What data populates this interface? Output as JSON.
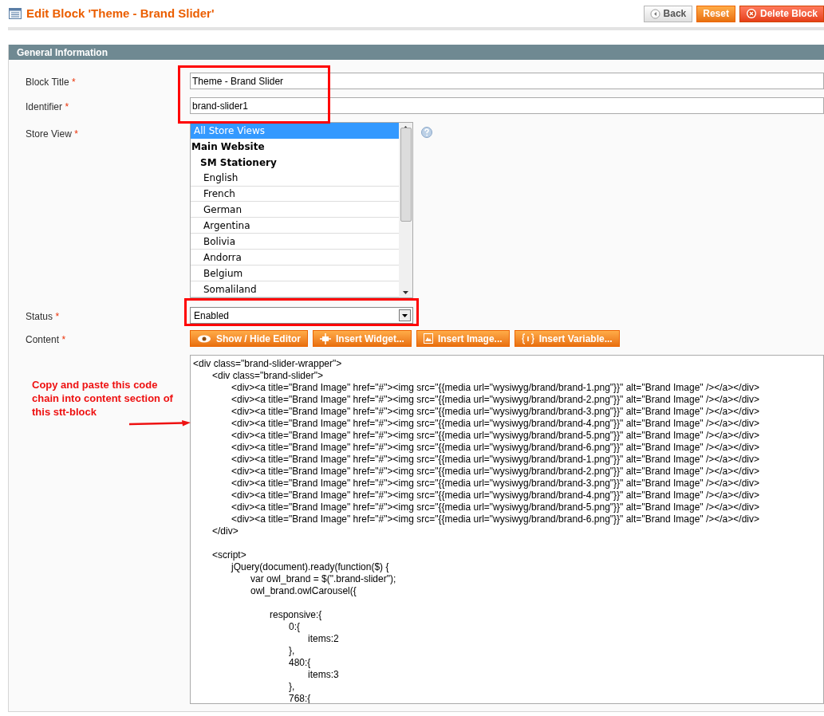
{
  "header": {
    "title": "Edit Block 'Theme - Brand Slider'",
    "buttons": [
      {
        "kind": "back",
        "label": "Back"
      },
      {
        "kind": "reset",
        "label": "Reset"
      },
      {
        "kind": "delete",
        "label": "Delete Block"
      }
    ]
  },
  "section": {
    "title": "General Information"
  },
  "fields": {
    "block_title": {
      "label": "Block Title",
      "required_mark": "*",
      "value": "Theme - Brand Slider"
    },
    "identifier": {
      "label": "Identifier",
      "required_mark": "*",
      "value": "brand-slider1"
    },
    "store_view": {
      "label": "Store View",
      "required_mark": "*",
      "options": [
        {
          "kind": "option",
          "label": "All Store Views",
          "selected": true
        },
        {
          "kind": "website",
          "label": "Main Website",
          "selected": false
        },
        {
          "kind": "store",
          "label": "SM Stationery",
          "selected": false
        },
        {
          "kind": "view",
          "label": "English",
          "selected": false
        },
        {
          "kind": "view",
          "label": "French",
          "selected": false
        },
        {
          "kind": "view",
          "label": "German",
          "selected": false
        },
        {
          "kind": "view",
          "label": "Argentina",
          "selected": false
        },
        {
          "kind": "view",
          "label": "Bolivia",
          "selected": false
        },
        {
          "kind": "view",
          "label": "Andorra",
          "selected": false
        },
        {
          "kind": "view",
          "label": "Belgium",
          "selected": false
        },
        {
          "kind": "view",
          "label": "Somaliland",
          "selected": false
        }
      ]
    },
    "status": {
      "label": "Status",
      "required_mark": "*",
      "value": "Enabled"
    },
    "content": {
      "label": "Content",
      "required_mark": "*",
      "buttons": [
        {
          "kind": "editor",
          "label": "Show / Hide Editor"
        },
        {
          "kind": "widget",
          "label": "Insert Widget..."
        },
        {
          "kind": "image",
          "label": "Insert Image..."
        },
        {
          "kind": "variable",
          "label": "Insert Variable..."
        }
      ],
      "value": "<div class=\"brand-slider-wrapper\">\n\t<div class=\"brand-slider\">\n\t\t<div><a title=\"Brand Image\" href=\"#\"><img src=\"{{media url=\"wysiwyg/brand/brand-1.png\"}}\" alt=\"Brand Image\" /></a></div>\n\t\t<div><a title=\"Brand Image\" href=\"#\"><img src=\"{{media url=\"wysiwyg/brand/brand-2.png\"}}\" alt=\"Brand Image\" /></a></div>\n\t\t<div><a title=\"Brand Image\" href=\"#\"><img src=\"{{media url=\"wysiwyg/brand/brand-3.png\"}}\" alt=\"Brand Image\" /></a></div>\n\t\t<div><a title=\"Brand Image\" href=\"#\"><img src=\"{{media url=\"wysiwyg/brand/brand-4.png\"}}\" alt=\"Brand Image\" /></a></div>\n\t\t<div><a title=\"Brand Image\" href=\"#\"><img src=\"{{media url=\"wysiwyg/brand/brand-5.png\"}}\" alt=\"Brand Image\" /></a></div>\n\t\t<div><a title=\"Brand Image\" href=\"#\"><img src=\"{{media url=\"wysiwyg/brand/brand-6.png\"}}\" alt=\"Brand Image\" /></a></div>\n\t\t<div><a title=\"Brand Image\" href=\"#\"><img src=\"{{media url=\"wysiwyg/brand/brand-1.png\"}}\" alt=\"Brand Image\" /></a></div>\n\t\t<div><a title=\"Brand Image\" href=\"#\"><img src=\"{{media url=\"wysiwyg/brand/brand-2.png\"}}\" alt=\"Brand Image\" /></a></div>\n\t\t<div><a title=\"Brand Image\" href=\"#\"><img src=\"{{media url=\"wysiwyg/brand/brand-3.png\"}}\" alt=\"Brand Image\" /></a></div>\n\t\t<div><a title=\"Brand Image\" href=\"#\"><img src=\"{{media url=\"wysiwyg/brand/brand-4.png\"}}\" alt=\"Brand Image\" /></a></div>\n\t\t<div><a title=\"Brand Image\" href=\"#\"><img src=\"{{media url=\"wysiwyg/brand/brand-5.png\"}}\" alt=\"Brand Image\" /></a></div>\n\t\t<div><a title=\"Brand Image\" href=\"#\"><img src=\"{{media url=\"wysiwyg/brand/brand-6.png\"}}\" alt=\"Brand Image\" /></a></div>\n\t</div>\n\n\t<script>\n\t\tjQuery(document).ready(function($) {\n\t\t\tvar owl_brand = $(\".brand-slider\");\n\t\t\towl_brand.owlCarousel({\n\n\t\t\t\tresponsive:{\n\t\t\t\t\t0:{\n\t\t\t\t\t\titems:2\n\t\t\t\t\t},\n\t\t\t\t\t480:{\n\t\t\t\t\t\titems:3\n\t\t\t\t\t},\n\t\t\t\t\t768:{"
    }
  },
  "annotation": {
    "text": "Copy and paste this code chain into content section of this stt-block"
  }
}
